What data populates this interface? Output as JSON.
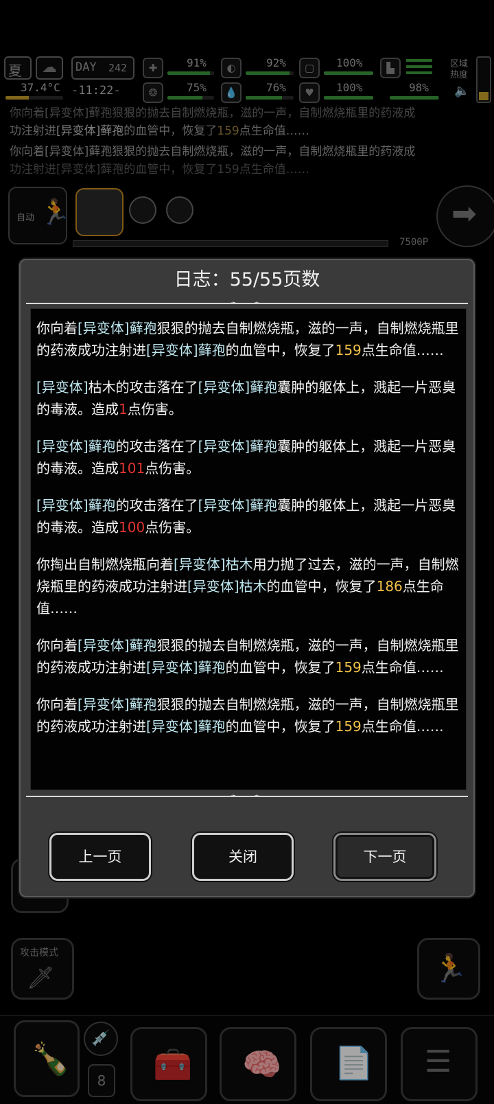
{
  "hud": {
    "season": "夏",
    "day_label": "DAY",
    "day_value": "242",
    "temperature": "37.4°C",
    "time": "-11:22-",
    "stats": [
      {
        "icon": "first-aid-icon",
        "value": "91%",
        "fill": 0.91,
        "color": "#3c9a3c"
      },
      {
        "icon": "stomach-icon",
        "value": "92%",
        "fill": 0.92,
        "color": "#3c9a3c"
      },
      {
        "icon": "stamina-icon",
        "value": "100%",
        "fill": 1.0,
        "color": "#3c9a3c"
      },
      {
        "icon": "brain-icon",
        "value": "75%",
        "fill": 0.75,
        "color": "#3c9a3c"
      },
      {
        "icon": "water-drop-icon",
        "value": "76%",
        "fill": 0.76,
        "color": "#3c9a3c"
      },
      {
        "icon": "heart-icon",
        "value": "100%",
        "fill": 1.0,
        "color": "#3c9a3c"
      },
      {
        "icon": "boot-icon",
        "value": "98%",
        "fill": 0.98,
        "color": "#3c9a3c"
      }
    ],
    "zone_heat_label": "区域热度"
  },
  "background_log": {
    "line1": "你向着[异变体]藓孢狠狠的抛去自制燃烧瓶，滋的一声，自制燃烧瓶里的药液成",
    "line2a": "功注射进",
    "line2b": "[异变体]藓孢",
    "line2c": "的血管中，恢复了",
    "line2d": "159",
    "line2e": "点生命值……",
    "line3": "你向着[异变体]藓孢狠狠的抛去自制燃烧瓶，滋的一声，自制燃烧瓶里的药液成",
    "line4": "功注射进[异变体]藓孢的血管中，恢复了159点生命值……"
  },
  "party": {
    "auto_label": "自动",
    "points": "7500P"
  },
  "modal": {
    "title": "日志：55/55页数",
    "entries": [
      {
        "p1": "你向着",
        "t1": "[异变体]藓孢",
        "p2": "狠狠的抛去自制燃烧瓶，滋的一声，自制燃烧瓶里的药液成功注射进",
        "t2": "[异变体]藓孢",
        "p3": "的血管中，恢复了",
        "heal": "159",
        "p4": "点生命值……"
      },
      {
        "t1": "[异变体]",
        "p1": "枯木的攻击落在了",
        "t2": "[异变体]藓孢",
        "p2": "囊肿的躯体上，溅起一片恶臭的毒液。造成",
        "dmg": "1",
        "p3": "点伤害。"
      },
      {
        "t1": "[异变体]藓孢",
        "p1": "的攻击落在了",
        "t2": "[异变体]藓孢",
        "p2": "囊肿的躯体上，溅起一片恶臭的毒液。造成",
        "dmg": "101",
        "p3": "点伤害。"
      },
      {
        "t1": "[异变体]藓孢",
        "p1": "的攻击落在了",
        "t2": "[异变体]藓孢",
        "p2": "囊肿的躯体上，溅起一片恶臭的毒液。造成",
        "dmg": "100",
        "p3": "点伤害。"
      },
      {
        "p1": "你掏出自制燃烧瓶向着",
        "t1": "[异变体]枯木",
        "p2": "用力抛了过去，滋的一声，自制燃烧瓶里的药液成功注射进",
        "t2": "[异变体]枯木",
        "p3": "的血管中，恢复了",
        "heal": "186",
        "p4": "点生命值……"
      },
      {
        "p1": "你向着",
        "t1": "[异变体]藓孢",
        "p2": "狠狠的抛去自制燃烧瓶，滋的一声，自制燃烧瓶里的药液成功注射进",
        "t2": "[异变体]藓孢",
        "p3": "的血管中，恢复了",
        "heal": "159",
        "p4": "点生命值……"
      },
      {
        "p1": "你向着",
        "t1": "[异变体]藓孢",
        "p2": "狠狠的抛去自制燃烧瓶，滋的一声，自制燃烧瓶里的药液成功注射进",
        "t2": "[异变体]藓孢",
        "p3": "的血管中，恢复了",
        "heal": "159",
        "p4": "点生命值……"
      }
    ],
    "prev_label": "上一页",
    "close_label": "关闭",
    "next_label": "下一页"
  },
  "bottom": {
    "attack_mode_label": "攻击模式",
    "item_count": "8"
  }
}
